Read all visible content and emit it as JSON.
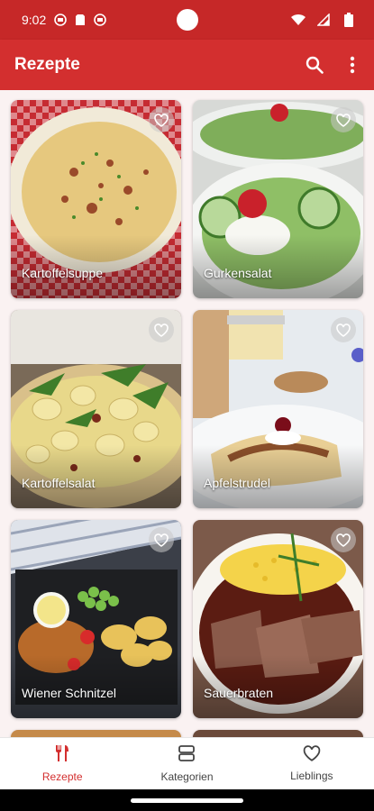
{
  "status_bar": {
    "time": "9:02",
    "left_icons": [
      "app-notification-icon",
      "sim-card-icon",
      "app-notification-icon"
    ],
    "right_icons": [
      "wifi-icon",
      "signal-icon",
      "battery-icon"
    ]
  },
  "app_bar": {
    "title": "Rezepte",
    "actions": [
      "search-icon",
      "more-vert-icon"
    ]
  },
  "recipes": [
    {
      "name": "Kartoffelsuppe",
      "favorite": false
    },
    {
      "name": "Gurkensalat",
      "favorite": false
    },
    {
      "name": "Kartoffelsalat",
      "favorite": false
    },
    {
      "name": "Apfelstrudel",
      "favorite": false
    },
    {
      "name": "Wiener Schnitzel",
      "favorite": false
    },
    {
      "name": "Sauerbraten",
      "favorite": false
    }
  ],
  "bottom_nav": {
    "items": [
      {
        "label": "Rezepte",
        "icon": "cutlery-icon",
        "active": true
      },
      {
        "label": "Kategorien",
        "icon": "categories-icon",
        "active": false
      },
      {
        "label": "Lieblings",
        "icon": "heart-icon",
        "active": false
      }
    ]
  },
  "colors": {
    "primary": "#d32f2f",
    "status_bar": "#c62828",
    "background": "#faf2f2"
  }
}
